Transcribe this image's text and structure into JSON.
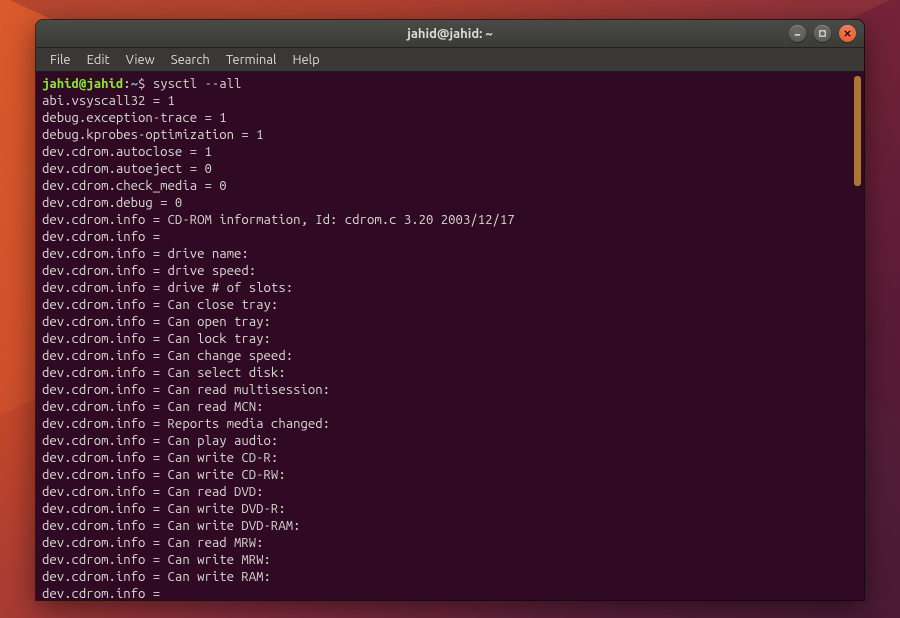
{
  "window": {
    "title": "jahid@jahid: ~"
  },
  "menubar": {
    "items": [
      "File",
      "Edit",
      "View",
      "Search",
      "Terminal",
      "Help"
    ]
  },
  "prompt": {
    "user_host": "jahid@jahid",
    "sep": ":",
    "path": "~",
    "symbol": "$"
  },
  "command": "sysctl --all",
  "output": [
    "abi.vsyscall32 = 1",
    "debug.exception-trace = 1",
    "debug.kprobes-optimization = 1",
    "dev.cdrom.autoclose = 1",
    "dev.cdrom.autoeject = 0",
    "dev.cdrom.check_media = 0",
    "dev.cdrom.debug = 0",
    "dev.cdrom.info = CD-ROM information, Id: cdrom.c 3.20 2003/12/17",
    "dev.cdrom.info =",
    "dev.cdrom.info = drive name:",
    "dev.cdrom.info = drive speed:",
    "dev.cdrom.info = drive # of slots:",
    "dev.cdrom.info = Can close tray:",
    "dev.cdrom.info = Can open tray:",
    "dev.cdrom.info = Can lock tray:",
    "dev.cdrom.info = Can change speed:",
    "dev.cdrom.info = Can select disk:",
    "dev.cdrom.info = Can read multisession:",
    "dev.cdrom.info = Can read MCN:",
    "dev.cdrom.info = Reports media changed:",
    "dev.cdrom.info = Can play audio:",
    "dev.cdrom.info = Can write CD-R:",
    "dev.cdrom.info = Can write CD-RW:",
    "dev.cdrom.info = Can read DVD:",
    "dev.cdrom.info = Can write DVD-R:",
    "dev.cdrom.info = Can write DVD-RAM:",
    "dev.cdrom.info = Can read MRW:",
    "dev.cdrom.info = Can write MRW:",
    "dev.cdrom.info = Can write RAM:",
    "dev.cdrom.info ="
  ]
}
